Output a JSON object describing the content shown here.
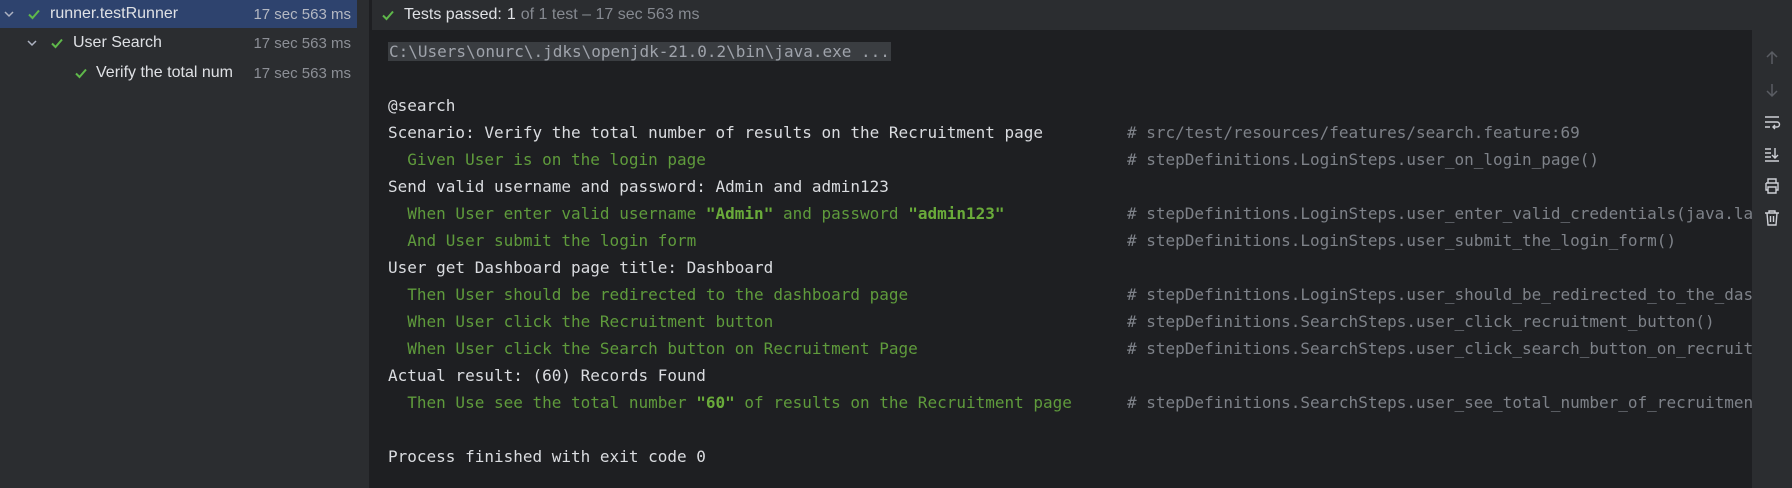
{
  "tree": {
    "items": [
      {
        "label": "runner.testRunner",
        "time": "17 sec 563 ms"
      },
      {
        "label": "User Search",
        "time": "17 sec 563 ms"
      },
      {
        "label": "Verify the total num",
        "time": "17 sec 563 ms"
      }
    ]
  },
  "header": {
    "passed_label": "Tests passed:",
    "passed_count": "1",
    "detail": "of 1 test – 17 sec 563 ms"
  },
  "console": {
    "command": "C:\\Users\\onurc\\.jdks\\openjdk-21.0.2\\bin\\java.exe ...",
    "tag": "@search",
    "scenario": "Scenario: Verify the total number of results on the Recruitment page",
    "scenario_comment": "# src/test/resources/features/search.feature:69",
    "step1": "  Given User is on the login page",
    "step1_comment": "# stepDefinitions.LoginSteps.user_on_login_page()",
    "out1": "Send valid username and password: Admin and admin123",
    "step2_a": "  When User enter valid username ",
    "step2_b": "\"Admin\"",
    "step2_c": " and password ",
    "step2_d": "\"admin123\"",
    "step2_comment": "# stepDefinitions.LoginSteps.user_enter_valid_credentials(java.la",
    "step3": "  And User submit the login form",
    "step3_comment": "# stepDefinitions.LoginSteps.user_submit_the_login_form()",
    "out2": "User get Dashboard page title: Dashboard",
    "step4": "  Then User should be redirected to the dashboard page",
    "step4_comment": "# stepDefinitions.LoginSteps.user_should_be_redirected_to_the_das",
    "step5": "  When User click the Recruitment button",
    "step5_comment": "# stepDefinitions.SearchSteps.user_click_recruitment_button()",
    "step6": "  When User click the Search button on Recruitment Page",
    "step6_comment": "# stepDefinitions.SearchSteps.user_click_search_button_on_recruit",
    "out3": "Actual result: (60) Records Found",
    "step7_a": "  Then Use see the total number ",
    "step7_b": "\"60\"",
    "step7_c": " of results on the Recruitment page",
    "step7_comment": "# stepDefinitions.SearchSteps.user_see_total_number_of_recruitmen",
    "exit": "Process finished with exit code 0"
  },
  "toolbar": {
    "icons": [
      "arrow-up-icon",
      "arrow-down-icon",
      "soft-wrap-icon",
      "scroll-to-end-icon",
      "print-icon",
      "trash-icon"
    ]
  },
  "colors": {
    "pass_green": "#5fb84a",
    "selection": "#2e436e",
    "console_green": "#5f9b3c",
    "comment_gray": "#7e8289"
  }
}
